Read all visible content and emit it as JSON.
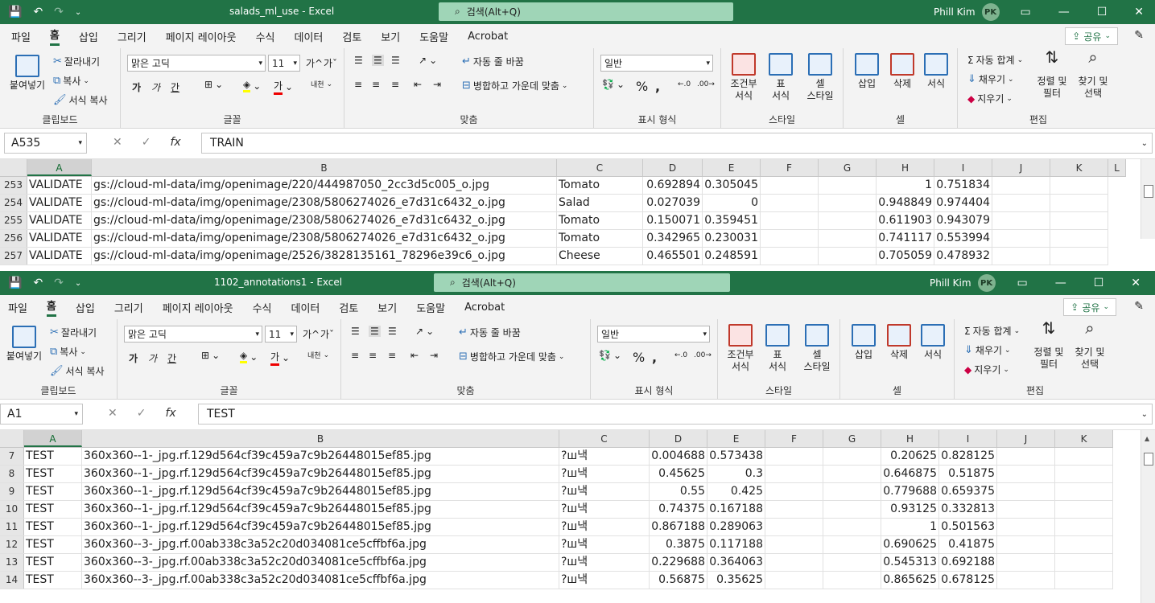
{
  "colors": {
    "excel_green": "#217346",
    "search_bg": "#9fd5b7"
  },
  "window1": {
    "title": "salads_ml_use  -  Excel",
    "search": "검색(Alt+Q)",
    "user": "Phill Kim",
    "avatar": "PK",
    "tabs": [
      "파일",
      "홈",
      "삽입",
      "그리기",
      "페이지 레이아웃",
      "수식",
      "데이터",
      "검토",
      "보기",
      "도움말",
      "Acrobat"
    ],
    "share": "공유",
    "namebox": "A535",
    "formula": "TRAIN",
    "columns": [
      "A",
      "B",
      "C",
      "D",
      "E",
      "F",
      "G",
      "H",
      "I",
      "J",
      "K",
      "L"
    ],
    "rows": [
      [
        "253",
        "VALIDATE",
        "gs://cloud-ml-data/img/openimage/220/444987050_2cc3d5c005_o.jpg",
        "Tomato",
        "0.692894",
        "0.305045",
        "",
        "",
        "1",
        "0.751834",
        "",
        ""
      ],
      [
        "254",
        "VALIDATE",
        "gs://cloud-ml-data/img/openimage/2308/5806274026_e7d31c6432_o.jpg",
        "Salad",
        "0.027039",
        "0",
        "",
        "",
        "0.948849",
        "0.974404",
        "",
        ""
      ],
      [
        "255",
        "VALIDATE",
        "gs://cloud-ml-data/img/openimage/2308/5806274026_e7d31c6432_o.jpg",
        "Tomato",
        "0.150071",
        "0.359451",
        "",
        "",
        "0.611903",
        "0.943079",
        "",
        ""
      ],
      [
        "256",
        "VALIDATE",
        "gs://cloud-ml-data/img/openimage/2308/5806274026_e7d31c6432_o.jpg",
        "Tomato",
        "0.342965",
        "0.230031",
        "",
        "",
        "0.741117",
        "0.553994",
        "",
        ""
      ],
      [
        "257",
        "VALIDATE",
        "gs://cloud-ml-data/img/openimage/2526/3828135161_78296e39c6_o.jpg",
        "Cheese",
        "0.465501",
        "0.248591",
        "",
        "",
        "0.705059",
        "0.478932",
        "",
        ""
      ]
    ]
  },
  "window2": {
    "title": "1102_annotations1  -  Excel",
    "search": "검색(Alt+Q)",
    "user": "Phill Kim",
    "avatar": "PK",
    "tabs": [
      "파일",
      "홈",
      "삽입",
      "그리기",
      "페이지 레이아웃",
      "수식",
      "데이터",
      "검토",
      "보기",
      "도움말",
      "Acrobat"
    ],
    "share": "공유",
    "namebox": "A1",
    "formula": "TEST",
    "columns": [
      "A",
      "B",
      "C",
      "D",
      "E",
      "F",
      "G",
      "H",
      "I",
      "J",
      "K"
    ],
    "rows": [
      [
        "7",
        "TEST",
        "360x360--1-_jpg.rf.129d564cf39c459a7c9b26448015ef85.jpg",
        "?ш낵",
        "0.004688",
        "0.573438",
        "",
        "",
        "0.20625",
        "0.828125",
        "",
        ""
      ],
      [
        "8",
        "TEST",
        "360x360--1-_jpg.rf.129d564cf39c459a7c9b26448015ef85.jpg",
        "?ш낵",
        "0.45625",
        "0.3",
        "",
        "",
        "0.646875",
        "0.51875",
        "",
        ""
      ],
      [
        "9",
        "TEST",
        "360x360--1-_jpg.rf.129d564cf39c459a7c9b26448015ef85.jpg",
        "?ш낵",
        "0.55",
        "0.425",
        "",
        "",
        "0.779688",
        "0.659375",
        "",
        ""
      ],
      [
        "10",
        "TEST",
        "360x360--1-_jpg.rf.129d564cf39c459a7c9b26448015ef85.jpg",
        "?ш낵",
        "0.74375",
        "0.167188",
        "",
        "",
        "0.93125",
        "0.332813",
        "",
        ""
      ],
      [
        "11",
        "TEST",
        "360x360--1-_jpg.rf.129d564cf39c459a7c9b26448015ef85.jpg",
        "?ш낵",
        "0.867188",
        "0.289063",
        "",
        "",
        "1",
        "0.501563",
        "",
        ""
      ],
      [
        "12",
        "TEST",
        "360x360--3-_jpg.rf.00ab338c3a52c20d034081ce5cffbf6a.jpg",
        "?ш낵",
        "0.3875",
        "0.117188",
        "",
        "",
        "0.690625",
        "0.41875",
        "",
        ""
      ],
      [
        "13",
        "TEST",
        "360x360--3-_jpg.rf.00ab338c3a52c20d034081ce5cffbf6a.jpg",
        "?ш낵",
        "0.229688",
        "0.364063",
        "",
        "",
        "0.545313",
        "0.692188",
        "",
        ""
      ],
      [
        "14",
        "TEST",
        "360x360--3-_jpg.rf.00ab338c3a52c20d034081ce5cffbf6a.jpg",
        "?ш낵",
        "0.56875",
        "0.35625",
        "",
        "",
        "0.865625",
        "0.678125",
        "",
        ""
      ]
    ]
  },
  "ribbon": {
    "clipboard": {
      "paste": "붙여넣기",
      "cut": "잘라내기",
      "copy": "복사",
      "format_painter": "서식 복사",
      "label": "클립보드"
    },
    "font": {
      "name": "맑은 고딕",
      "size": "11",
      "bold": "가",
      "italic": "가",
      "underline": "간",
      "label": "글꼴"
    },
    "alignment": {
      "wrap": "자동 줄 바꿈",
      "merge": "병합하고 가운데 맞춤",
      "label": "맞춤"
    },
    "number": {
      "format": "일반",
      "label": "표시 형식"
    },
    "styles": {
      "conditional": "조건부\n서식",
      "table": "표\n서식",
      "cell": "셀\n스타일",
      "label": "스타일"
    },
    "cells": {
      "insert": "삽입",
      "delete": "삭제",
      "format": "서식",
      "label": "셀"
    },
    "editing": {
      "autosum": "자동 합계",
      "fill": "채우기",
      "clear": "지우기",
      "sort": "정렬 및\n필터",
      "find": "찾기 및\n선택",
      "label": "편집"
    }
  }
}
